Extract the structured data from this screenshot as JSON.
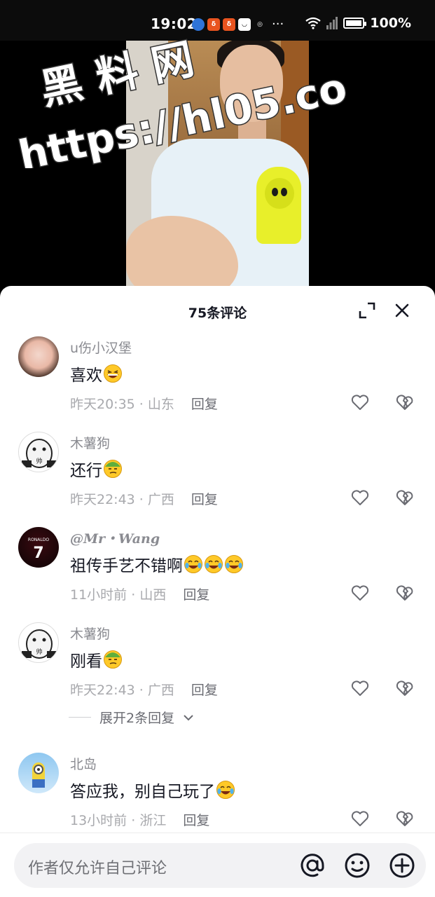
{
  "status_bar": {
    "time": "19:02",
    "battery": "100%",
    "battery_level": 1.0,
    "more": "···"
  },
  "watermark": {
    "line1": "黑 料 网",
    "line2": "https://hl05.co"
  },
  "sheet": {
    "title": "75条评论"
  },
  "comments": [
    {
      "name": "u伤小汉堡",
      "text": "喜欢",
      "emojis": [
        "grin"
      ],
      "time": "昨天20:35",
      "sep": " · ",
      "location": "山东",
      "reply": "回复"
    },
    {
      "name": "木薯狗",
      "text": "还行",
      "emojis": [
        "smirk"
      ],
      "time": "昨天22:43",
      "sep": " · ",
      "location": "广西",
      "reply": "回复"
    },
    {
      "name": "@Mr・Wang",
      "text": "祖传手艺不错啊",
      "emojis": [
        "laugh",
        "laugh",
        "laugh"
      ],
      "time": "11小时前",
      "sep": " · ",
      "location": "山西",
      "reply": "回复"
    },
    {
      "name": "木薯狗",
      "text": "刚看",
      "emojis": [
        "smirk"
      ],
      "time": "昨天22:43",
      "sep": " · ",
      "location": "广西",
      "reply": "回复"
    },
    {
      "name": "北岛",
      "text": "答应我，别自己玩了",
      "emojis": [
        "laugh"
      ],
      "time": "13小时前",
      "sep": " · ",
      "location": "浙江",
      "reply": "回复"
    }
  ],
  "expand_replies": "展开2条回复",
  "input": {
    "placeholder": "作者仅允许自己评论"
  }
}
